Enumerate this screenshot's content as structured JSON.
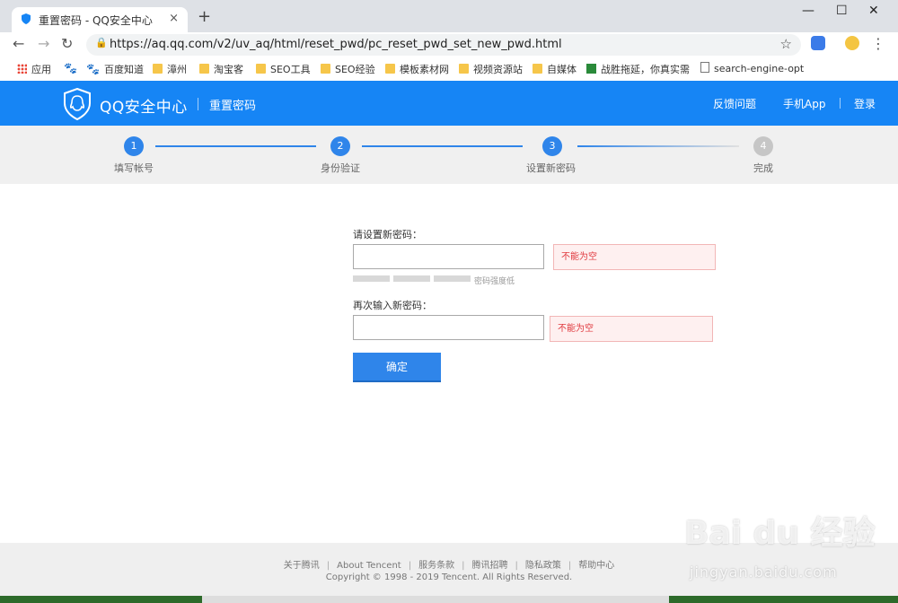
{
  "browser": {
    "tab_title": "重置密码 - QQ安全中心",
    "tab_close": "×",
    "new_tab": "+",
    "url": "https://aq.qq.com/v2/uv_aq/html/reset_pwd/pc_reset_pwd_set_new_pwd.html",
    "back": "←",
    "forward": "→",
    "reload": "↻",
    "lock": "🔒",
    "star": "☆",
    "menu": "⋮",
    "minimize": "—",
    "maximize": "☐",
    "close": "✕"
  },
  "bookmarks": [
    {
      "label": "应用",
      "icon": "apps-icon"
    },
    {
      "label": "",
      "icon": "baidu-paw-icon"
    },
    {
      "label": "百度知道",
      "icon": "baidu-paw-icon"
    },
    {
      "label": "漳州",
      "icon": "folder-icon"
    },
    {
      "label": "淘宝客",
      "icon": "folder-icon"
    },
    {
      "label": "SEO工具",
      "icon": "folder-icon"
    },
    {
      "label": "SEO经验",
      "icon": "folder-icon"
    },
    {
      "label": "模板素材网",
      "icon": "folder-icon"
    },
    {
      "label": "视频资源站",
      "icon": "folder-icon"
    },
    {
      "label": "自媒体",
      "icon": "folder-icon"
    },
    {
      "label": "战胜拖延，你真实需",
      "icon": "douban-icon"
    },
    {
      "label": "search-engine-optin",
      "icon": "document-icon"
    }
  ],
  "header": {
    "brand": "QQ安全中心",
    "subtitle": "重置密码",
    "links": [
      "反馈问题",
      "手机App",
      "登录"
    ],
    "accent": "#1685f5"
  },
  "steps": [
    {
      "num": "1",
      "label": "填写帐号",
      "done": true
    },
    {
      "num": "2",
      "label": "身份验证",
      "done": true
    },
    {
      "num": "3",
      "label": "设置新密码",
      "done": true
    },
    {
      "num": "4",
      "label": "完成",
      "done": false
    }
  ],
  "form": {
    "new_pwd_label": "请设置新密码：",
    "new_pwd_value": "",
    "new_pwd_error": "不能为空",
    "strength_text": "密码强度低",
    "confirm_label": "再次输入新密码：",
    "confirm_value": "",
    "confirm_error": "不能为空",
    "submit": "确定"
  },
  "footer": {
    "links": [
      "关于腾讯",
      "About Tencent",
      "服务条款",
      "腾讯招聘",
      "隐私政策",
      "帮助中心"
    ],
    "separator": "|",
    "copyright": "Copyright © 1998 - 2019 Tencent. All Rights Reserved."
  },
  "watermark": {
    "text": "Bai du 经验",
    "url": "jingyan.baidu.com"
  }
}
